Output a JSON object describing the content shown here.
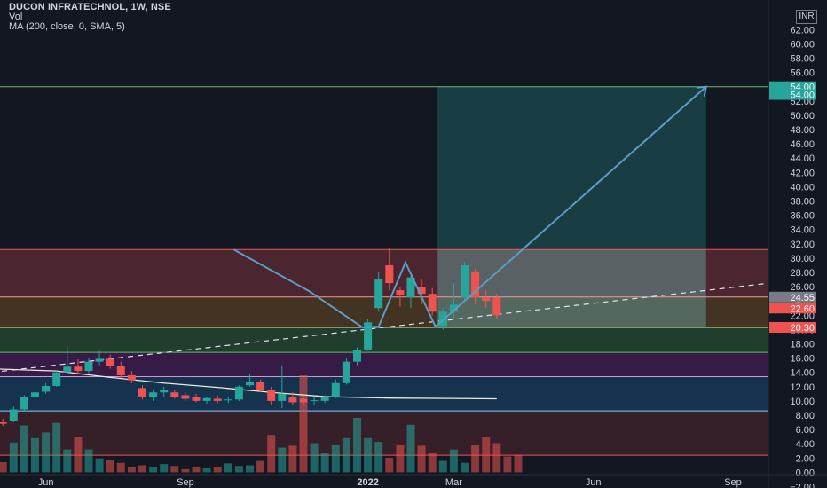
{
  "legend": {
    "title": "DUCON INFRATECHNOL, 1W, NSE",
    "vol": "Vol",
    "ma": "MA (200, close, 0, SMA, 5)"
  },
  "currency": "INR",
  "colors": {
    "background": "#131722",
    "up": "#26a69a",
    "down": "#ef5350",
    "axis_text": "#d1d4dc",
    "ma_line": "#f0ead2",
    "projection": "#5b9cc9",
    "target_line": "#66bb6a"
  },
  "chart_data": {
    "type": "candlestick",
    "y_range": [
      -2,
      64
    ],
    "y_ticks": [
      62,
      60,
      58,
      56,
      54,
      52,
      50,
      48,
      46,
      44,
      42,
      40,
      38,
      36,
      34,
      32,
      30,
      28,
      26,
      24,
      22,
      20,
      18,
      16,
      14,
      12,
      10,
      8,
      6,
      4,
      2,
      0,
      -2
    ],
    "x_labels": [
      {
        "label": "Jun",
        "week": 4
      },
      {
        "label": "Sep",
        "week": 17
      },
      {
        "label": "2022",
        "week": 34,
        "bold": true
      },
      {
        "label": "Mar",
        "week": 42
      },
      {
        "label": "Jun",
        "week": 55
      },
      {
        "label": "Sep",
        "week": 68
      }
    ],
    "price_labels": [
      {
        "text": "54.00",
        "value": 54.0,
        "color": "#26a69a",
        "kind": "target"
      },
      {
        "text": "54.00",
        "value": 52.9,
        "color": "#26a69a",
        "kind": "target"
      },
      {
        "text": "24.55",
        "value": 24.55,
        "color": "#787b86",
        "kind": "tag"
      },
      {
        "text": "22.60",
        "value": 23.0,
        "color": "#ef5350",
        "kind": "tag"
      },
      {
        "text": "20.30",
        "value": 20.3,
        "color": "#ef5350",
        "kind": "tag"
      }
    ],
    "zones": [
      {
        "from": 24.55,
        "to": 31.2,
        "color": "rgba(239,83,80,0.26)"
      },
      {
        "from": 20.3,
        "to": 24.55,
        "color": "rgba(255,167,38,0.20)"
      },
      {
        "from": 16.8,
        "to": 20.3,
        "color": "rgba(76,175,80,0.25)"
      },
      {
        "from": 13.4,
        "to": 16.8,
        "color": "rgba(156,39,176,0.25)"
      },
      {
        "from": 8.6,
        "to": 13.4,
        "color": "rgba(33,150,243,0.22)"
      },
      {
        "from": 2.4,
        "to": 8.6,
        "color": "rgba(239,83,80,0.16)"
      }
    ],
    "levels": [
      {
        "value": 54.0,
        "color": "#66bb6a"
      },
      {
        "value": 31.2,
        "color": "#ef5350"
      },
      {
        "value": 24.55,
        "color": "#ef9a9a"
      },
      {
        "value": 20.3,
        "color": "#e6ee9c"
      },
      {
        "value": 16.8,
        "color": "#66bb6a"
      },
      {
        "value": 13.4,
        "color": "#ce93d8"
      },
      {
        "value": 8.6,
        "color": "#90caf9"
      },
      {
        "value": 2.4,
        "color": "#ef5350"
      }
    ],
    "target_box": {
      "week_from": 40.5,
      "week_to": 65.5,
      "top": 54.0,
      "bottom": 20.3
    },
    "stop_box": {
      "week_from": 40.5,
      "week_to": 65.5,
      "top": 31.2,
      "bottom": 20.3
    },
    "candles": [
      {
        "o": 7.0,
        "h": 7.5,
        "l": 6.5,
        "c": 6.8
      },
      {
        "o": 7.2,
        "h": 9.2,
        "l": 7.0,
        "c": 8.8
      },
      {
        "o": 8.8,
        "h": 10.8,
        "l": 8.6,
        "c": 10.5
      },
      {
        "o": 10.5,
        "h": 11.5,
        "l": 10.0,
        "c": 11.2
      },
      {
        "o": 11.3,
        "h": 12.5,
        "l": 11.0,
        "c": 12.1
      },
      {
        "o": 12.1,
        "h": 14.2,
        "l": 12.0,
        "c": 14.0
      },
      {
        "o": 14.0,
        "h": 17.5,
        "l": 13.8,
        "c": 14.8
      },
      {
        "o": 14.8,
        "h": 15.8,
        "l": 13.8,
        "c": 14.2
      },
      {
        "o": 14.2,
        "h": 16.0,
        "l": 13.9,
        "c": 15.5
      },
      {
        "o": 15.5,
        "h": 17.0,
        "l": 15.0,
        "c": 15.9
      },
      {
        "o": 15.9,
        "h": 16.5,
        "l": 14.5,
        "c": 14.9
      },
      {
        "o": 14.9,
        "h": 15.5,
        "l": 13.2,
        "c": 13.6
      },
      {
        "o": 13.6,
        "h": 14.2,
        "l": 12.5,
        "c": 12.9
      },
      {
        "o": 11.8,
        "h": 12.2,
        "l": 10.2,
        "c": 10.5
      },
      {
        "o": 10.5,
        "h": 11.5,
        "l": 10.0,
        "c": 11.2
      },
      {
        "o": 11.2,
        "h": 12.0,
        "l": 10.5,
        "c": 11.6
      },
      {
        "o": 11.2,
        "h": 11.6,
        "l": 10.3,
        "c": 10.6
      },
      {
        "o": 10.8,
        "h": 11.2,
        "l": 10.0,
        "c": 10.3
      },
      {
        "o": 10.6,
        "h": 11.0,
        "l": 9.8,
        "c": 10.0
      },
      {
        "o": 10.0,
        "h": 10.6,
        "l": 9.6,
        "c": 10.4
      },
      {
        "o": 10.3,
        "h": 10.8,
        "l": 9.7,
        "c": 10.0
      },
      {
        "o": 10.1,
        "h": 10.5,
        "l": 9.7,
        "c": 10.2
      },
      {
        "o": 10.2,
        "h": 12.2,
        "l": 10.0,
        "c": 12.0
      },
      {
        "o": 12.2,
        "h": 13.8,
        "l": 12.0,
        "c": 12.7
      },
      {
        "o": 12.6,
        "h": 13.0,
        "l": 11.3,
        "c": 11.5
      },
      {
        "o": 11.5,
        "h": 12.0,
        "l": 9.5,
        "c": 10.0
      },
      {
        "o": 10.0,
        "h": 15.0,
        "l": 9.0,
        "c": 11.0
      },
      {
        "o": 10.6,
        "h": 11.2,
        "l": 9.5,
        "c": 9.8
      },
      {
        "o": 10.3,
        "h": 10.8,
        "l": 9.4,
        "c": 9.8
      },
      {
        "o": 10.0,
        "h": 10.5,
        "l": 9.4,
        "c": 10.1
      },
      {
        "o": 10.0,
        "h": 10.8,
        "l": 9.7,
        "c": 10.6
      },
      {
        "o": 10.6,
        "h": 13.0,
        "l": 10.4,
        "c": 12.5
      },
      {
        "o": 12.5,
        "h": 16.0,
        "l": 12.3,
        "c": 15.5
      },
      {
        "o": 15.5,
        "h": 17.5,
        "l": 15.0,
        "c": 17.2
      },
      {
        "o": 17.2,
        "h": 21.5,
        "l": 17.0,
        "c": 21.0
      },
      {
        "o": 23.0,
        "h": 28.0,
        "l": 22.5,
        "c": 27.0
      },
      {
        "o": 29.0,
        "h": 31.5,
        "l": 25.5,
        "c": 26.5
      },
      {
        "o": 25.5,
        "h": 26.0,
        "l": 23.2,
        "c": 24.8
      },
      {
        "o": 24.5,
        "h": 27.5,
        "l": 23.0,
        "c": 27.3
      },
      {
        "o": 26.0,
        "h": 27.0,
        "l": 23.5,
        "c": 25.0
      },
      {
        "o": 25.0,
        "h": 25.8,
        "l": 22.0,
        "c": 22.5
      },
      {
        "o": 20.5,
        "h": 23.0,
        "l": 20.0,
        "c": 22.5
      },
      {
        "o": 22.5,
        "h": 26.5,
        "l": 21.5,
        "c": 23.5
      },
      {
        "o": 24.5,
        "h": 29.5,
        "l": 24.0,
        "c": 29.0
      },
      {
        "o": 28.0,
        "h": 28.5,
        "l": 23.5,
        "c": 24.5
      },
      {
        "o": 24.5,
        "h": 25.5,
        "l": 23.0,
        "c": 24.0
      },
      {
        "o": 24.5,
        "h": 25.0,
        "l": 21.5,
        "c": 22.0
      }
    ],
    "volumes": [
      1.6,
      4.7,
      7.4,
      5.4,
      6.3,
      7.8,
      3.6,
      5.5,
      3.6,
      2.2,
      1.9,
      1.5,
      0.9,
      1.1,
      0.9,
      1.3,
      1.0,
      0.5,
      0.9,
      0.7,
      0.9,
      1.4,
      1.0,
      1.1,
      1.8,
      5.9,
      3.9,
      4.2,
      15.3,
      4.6,
      3.1,
      4.4,
      5.4,
      8.6,
      5.4,
      4.8,
      2.3,
      4.4,
      7.5,
      4.2,
      3.0,
      1.8,
      3.6,
      1.5,
      4.3,
      5.5,
      4.6,
      2.5,
      2.7
    ],
    "ma_line": [
      {
        "week": -3,
        "v": 14.6
      },
      {
        "week": 5,
        "v": 14.2
      },
      {
        "week": 10,
        "v": 13.3
      },
      {
        "week": 15,
        "v": 12.5
      },
      {
        "week": 20,
        "v": 11.9
      },
      {
        "week": 25,
        "v": 11.2
      },
      {
        "week": 30,
        "v": 10.6
      },
      {
        "week": 36,
        "v": 10.4
      },
      {
        "week": 46,
        "v": 10.3
      }
    ],
    "projection_path": [
      {
        "week": 21.5,
        "v": 31.2
      },
      {
        "week": 28.5,
        "v": 25.4
      },
      {
        "week": 33.5,
        "v": 20.3
      },
      {
        "week": 35.0,
        "v": 20.4
      },
      {
        "week": 37.5,
        "v": 29.4
      },
      {
        "week": 40.3,
        "v": 20.4
      },
      {
        "week": 65.5,
        "v": 54.0
      }
    ],
    "projection_arrow": {
      "week": 65.5,
      "v": 54.0
    },
    "trendline": {
      "from": {
        "week": -1,
        "v": 14.0
      },
      "to": {
        "week": 72,
        "v": 26.6
      }
    }
  }
}
